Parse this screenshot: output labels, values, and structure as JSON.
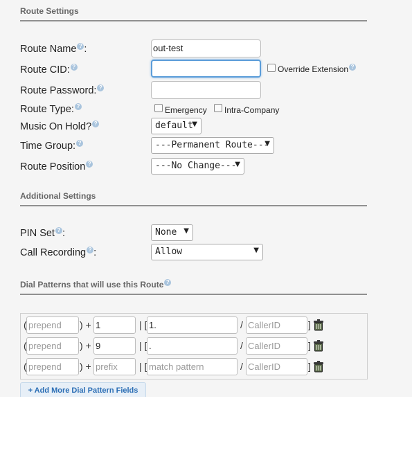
{
  "route_settings": {
    "title": "Route Settings",
    "route_name": {
      "label": "Route Name",
      "suffix": ":",
      "value": "out-test"
    },
    "route_cid": {
      "label": "Route CID:",
      "value": "",
      "override_label": "Override Extension"
    },
    "route_password": {
      "label": "Route Password:",
      "value": ""
    },
    "route_type": {
      "label": "Route Type:",
      "options": [
        "Emergency",
        "Intra-Company"
      ]
    },
    "music_on_hold": {
      "label": "Music On Hold?",
      "value": "default"
    },
    "time_group": {
      "label": "Time Group:",
      "value": "---Permanent Route---"
    },
    "route_position": {
      "label": "Route Position",
      "value": "---No Change---"
    }
  },
  "additional_settings": {
    "title": "Additional Settings",
    "pin_set": {
      "label": "PIN Set",
      "suffix": ":",
      "value": "None"
    },
    "call_recording": {
      "label": "Call Recording",
      "suffix": ":",
      "value": "Allow"
    }
  },
  "dial_patterns": {
    "title": "Dial Patterns that will use this Route",
    "rows": [
      {
        "prepend": "",
        "prefix": "1",
        "match_pattern": "1.",
        "caller_id": ""
      },
      {
        "prepend": "",
        "prefix": "9",
        "match_pattern": ".",
        "caller_id": ""
      },
      {
        "prepend": "",
        "prefix": "",
        "match_pattern": "",
        "caller_id": ""
      }
    ],
    "placeholders": {
      "prepend": "prepend",
      "prefix": "prefix",
      "match_pattern": "match pattern",
      "caller_id": "CallerID"
    },
    "symbols": {
      "open_paren": "(",
      "close_plus": ") +",
      "bracket": "| [",
      "slash": "/",
      "close_bracket": "]"
    },
    "add_button": "+ Add More Dial Pattern Fields"
  },
  "help_glyph": "?",
  "icons": {
    "help": "question-circle-icon",
    "delete": "trash-icon",
    "dropdown": "chevron-down-icon"
  },
  "colors": {
    "accent": "#5b9dd9",
    "link": "#2a6db4",
    "help": "#a9c4dd"
  }
}
